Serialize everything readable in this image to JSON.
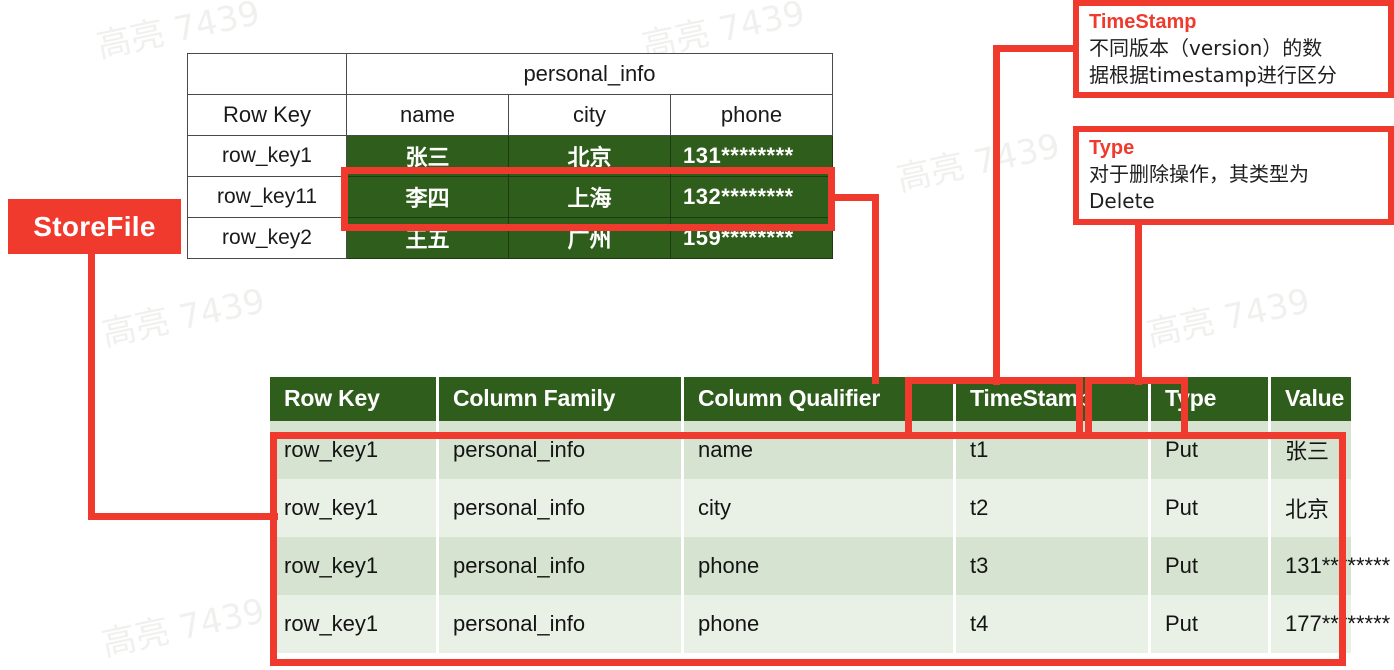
{
  "diagram": {
    "store_file_label": "StoreFile"
  },
  "logical_table": {
    "column_family_header": "personal_info",
    "headers": [
      "Row Key",
      "name",
      "city",
      "phone"
    ],
    "rows": [
      {
        "row_key": "row_key1",
        "name": "张三",
        "city": "北京",
        "phone": "131********"
      },
      {
        "row_key": "row_key11",
        "name": "李四",
        "city": "上海",
        "phone": "132********"
      },
      {
        "row_key": "row_key2",
        "name": "王五",
        "city": "广州",
        "phone": "159********"
      }
    ]
  },
  "cell_table": {
    "headers": [
      "Row Key",
      "Column Family",
      "Column Qualifier",
      "TimeStamp",
      "Type",
      "Value"
    ],
    "rows": [
      {
        "row_key": "row_key1",
        "column_family": "personal_info",
        "column_qualifier": "name",
        "timestamp": "t1",
        "type": "Put",
        "value": "张三"
      },
      {
        "row_key": "row_key1",
        "column_family": "personal_info",
        "column_qualifier": "city",
        "timestamp": "t2",
        "type": "Put",
        "value": "北京"
      },
      {
        "row_key": "row_key1",
        "column_family": "personal_info",
        "column_qualifier": "phone",
        "timestamp": "t3",
        "type": "Put",
        "value": "131********"
      },
      {
        "row_key": "row_key1",
        "column_family": "personal_info",
        "column_qualifier": "phone",
        "timestamp": "t4",
        "type": "Put",
        "value": "177********"
      }
    ]
  },
  "callouts": {
    "timestamp": {
      "title": "TimeStamp",
      "line1": "不同版本（version）的数",
      "line2": "据根据timestamp进行区分"
    },
    "type": {
      "title": "Type",
      "line1": "对于删除操作，其类型为",
      "line2": "Delete"
    }
  },
  "watermarks": [
    "高亮 7439",
    "高亮 7439",
    "高亮 7439",
    "高亮 7439",
    "高亮 7439",
    "高亮 7439",
    "高亮 7439",
    "高亮 7439",
    "高亮 7439",
    "高亮 7439"
  ],
  "colors": {
    "accent_red": "#f03a2e",
    "header_green": "#2f5d1b",
    "row_green_dark": "#d6e3d0",
    "row_green_light": "#e9f1e6"
  }
}
